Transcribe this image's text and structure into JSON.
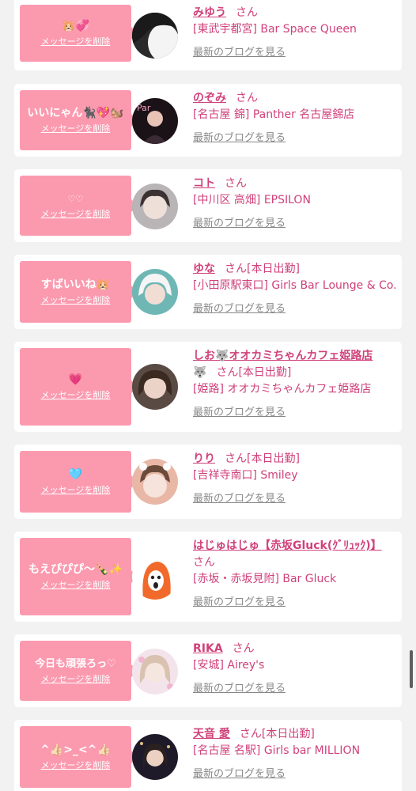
{
  "delete_label": "メッセージを削除",
  "san_label": "さん",
  "blog_label": "最新のブログを見る",
  "accent_color": "#fb9aaf",
  "text_color": "#d0417a",
  "items": [
    {
      "message": "🐹💞",
      "name": "みゆう",
      "badge": "",
      "shop": "[東武宇都宮] Bar Space Queen"
    },
    {
      "message": "いいにゃん🐈‍⬛💖🐿️",
      "name": "のぞみ",
      "badge": "",
      "shop": "[名古屋 錦] Panther 名古屋錦店"
    },
    {
      "message": "♡♡",
      "name": "コト",
      "badge": "",
      "shop": "[中川区 高畑] EPSILON"
    },
    {
      "message": "すばいいね🐹",
      "name": "ゆな",
      "badge": "[本日出勤]",
      "shop": "[小田原駅東口] Girls Bar Lounge & Co."
    },
    {
      "message": "💗",
      "name": "しお🐺オオカミちゃんカフェ姫路店",
      "name_suffix": "🐺",
      "badge": "[本日出勤]",
      "shop": "[姫路] オオカミちゃんカフェ姫路店"
    },
    {
      "message": "🩵",
      "name": "りり",
      "badge": "[本日出勤]",
      "shop": "[吉祥寺南口] Smiley"
    },
    {
      "message": "もえぴぴぴ〜🍾✨",
      "name": "はじゅはじゅ【赤坂Gluck(ｸﾞﾘｭｯｸ)】",
      "badge": "",
      "shop": "[赤坂・赤坂見附] Bar Gluck"
    },
    {
      "message": "今日も頑張ろっ♡",
      "name": "RIKA",
      "badge": "",
      "shop": "[安城] Airey's"
    },
    {
      "message": "^👍🏻>_<^👍🏻",
      "name": "天音 愛",
      "badge": "[本日出勤]",
      "shop": "[名古屋 名駅] Girls bar MILLION"
    }
  ]
}
